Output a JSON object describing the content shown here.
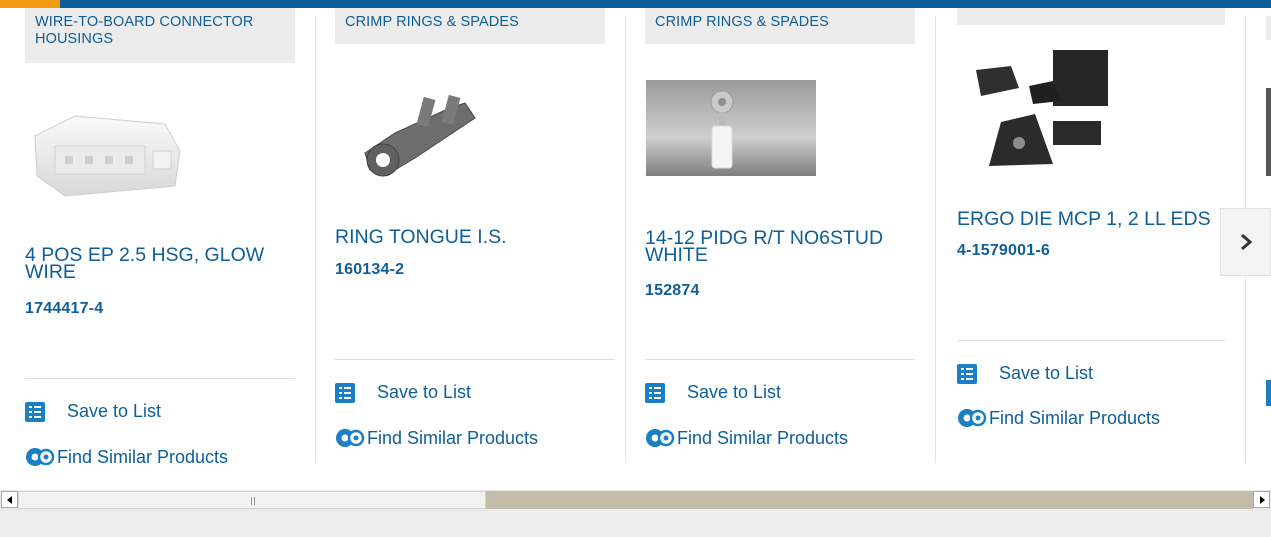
{
  "brand": {
    "accent_color": "#0e5e99",
    "highlight_color": "#f39c12"
  },
  "products": [
    {
      "category": "WIRE-TO-BOARD CONNECTOR HOUSINGS",
      "title": "4 POS EP 2.5 HSG, GLOW WIRE",
      "part_number": "1744417-4",
      "save_label": "Save to List",
      "similar_label": "Find Similar Products",
      "image_icon": "white-connector-housing"
    },
    {
      "category": "CRIMP RINGS & SPADES",
      "title": "RING TONGUE I.S.",
      "part_number": "160134-2",
      "save_label": "Save to List",
      "similar_label": "Find Similar Products",
      "image_icon": "ring-tongue-terminal"
    },
    {
      "category": "CRIMP RINGS & SPADES",
      "title": "14-12 PIDG R/T NO6STUD WHITE",
      "part_number": "152874",
      "save_label": "Save to List",
      "similar_label": "Find Similar Products",
      "image_icon": "insulated-ring-terminal"
    },
    {
      "category": "",
      "title": "ERGO DIE MCP 1, 2 LL EDS",
      "part_number": "4-1579001-6",
      "save_label": "Save to List",
      "similar_label": "Find Similar Products",
      "image_icon": "crimp-die-set"
    }
  ],
  "carousel": {
    "next_icon": "chevron-right-icon"
  },
  "scrollbar": {
    "left_icon": "arrow-left-icon",
    "right_icon": "arrow-right-icon"
  }
}
